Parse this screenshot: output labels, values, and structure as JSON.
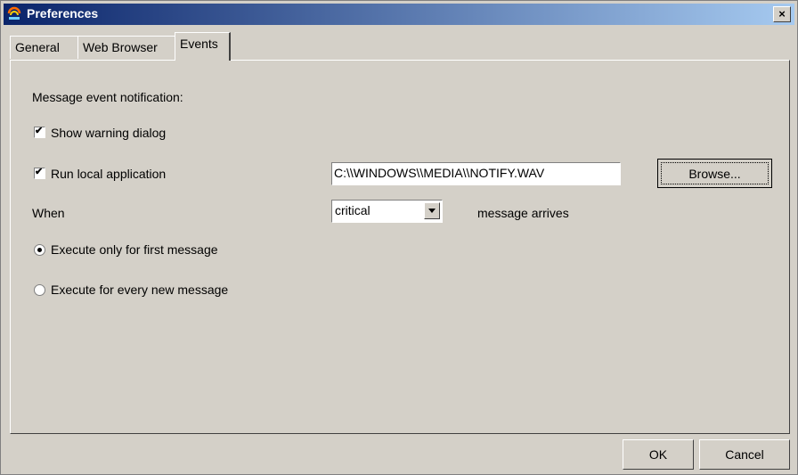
{
  "window": {
    "title": "Preferences",
    "close_label": "×"
  },
  "tabs": [
    {
      "label": "General"
    },
    {
      "label": "Web Browser"
    },
    {
      "label": "Events",
      "active": true
    }
  ],
  "events": {
    "heading": "Message event notification:",
    "show_warning": {
      "label": "Show warning dialog",
      "checked": true
    },
    "run_local": {
      "label": "Run local application",
      "checked": true
    },
    "path_value": "C:\\\\WINDOWS\\\\MEDIA\\\\NOTIFY.WAV",
    "browse_label": "Browse...",
    "when_label": "When",
    "severity_selected": "critical",
    "arrives_label": "message arrives",
    "first_message": {
      "label": "Execute only for first message",
      "selected": true
    },
    "every_message": {
      "label": "Execute for every new message",
      "selected": false
    }
  },
  "footer": {
    "ok_label": "OK",
    "cancel_label": "Cancel"
  }
}
